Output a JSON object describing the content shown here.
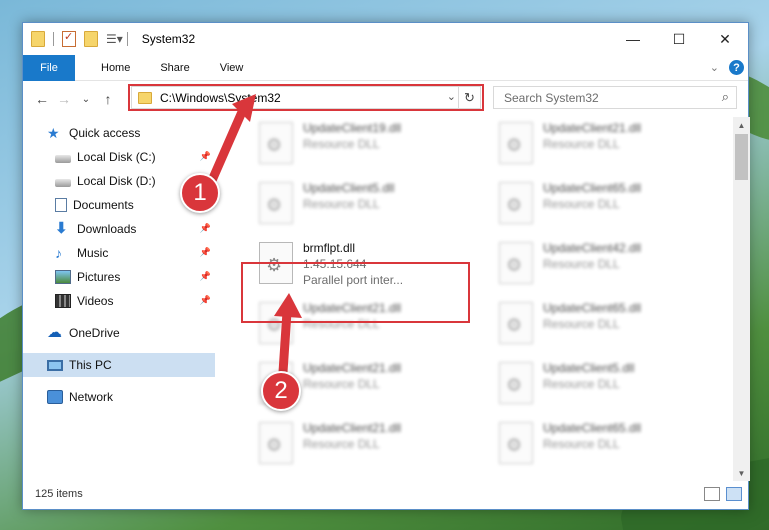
{
  "window": {
    "title": "System32",
    "controls": {
      "minimize": "—",
      "maximize": "☐",
      "close": "✕"
    }
  },
  "ribbon": {
    "tabs": [
      "File",
      "Home",
      "Share",
      "View"
    ],
    "help": "?"
  },
  "address": {
    "path": "C:\\Windows\\System32",
    "search_placeholder": "Search System32"
  },
  "sidebar": {
    "items": [
      {
        "label": "Quick access",
        "icon": "star-icon"
      },
      {
        "label": "Local Disk (C:)",
        "icon": "drive-icon",
        "pinned": true
      },
      {
        "label": "Local Disk (D:)",
        "icon": "drive-icon"
      },
      {
        "label": "Documents",
        "icon": "document-icon"
      },
      {
        "label": "Downloads",
        "icon": "download-icon",
        "pinned": true
      },
      {
        "label": "Music",
        "icon": "music-icon",
        "pinned": true
      },
      {
        "label": "Pictures",
        "icon": "pictures-icon",
        "pinned": true
      },
      {
        "label": "Videos",
        "icon": "videos-icon",
        "pinned": true
      },
      {
        "label": "OneDrive",
        "icon": "onedrive-icon"
      },
      {
        "label": "This PC",
        "icon": "pc-icon",
        "selected": true
      },
      {
        "label": "Network",
        "icon": "network-icon"
      }
    ]
  },
  "files": [
    {
      "name": "UpdateClient19.dll",
      "desc": "Resource DLL"
    },
    {
      "name": "UpdateClient21.dll",
      "desc": "Resource DLL"
    },
    {
      "name": "UpdateClient5.dll",
      "desc": "Resource DLL"
    },
    {
      "name": "UpdateClient65.dll",
      "desc": "Resource DLL"
    },
    {
      "name": "brmflpt.dll",
      "version": "1.45.15.644",
      "desc": "Parallel port inter...",
      "focused": true
    },
    {
      "name": "UpdateClient42.dll",
      "desc": "Resource DLL"
    },
    {
      "name": "UpdateClient21.dll",
      "desc": "Resource DLL"
    },
    {
      "name": "UpdateClient65.dll",
      "desc": "Resource DLL"
    },
    {
      "name": "UpdateClient21.dll",
      "desc": "Resource DLL"
    },
    {
      "name": "UpdateClient5.dll",
      "desc": "Resource DLL"
    },
    {
      "name": "UpdateClient21.dll",
      "desc": "Resource DLL"
    },
    {
      "name": "UpdateClient65.dll",
      "desc": "Resource DLL"
    }
  ],
  "status": {
    "count": "125 items"
  },
  "callouts": [
    "1",
    "2"
  ],
  "colors": {
    "accent": "#1979ca",
    "highlight": "#d9363b"
  }
}
